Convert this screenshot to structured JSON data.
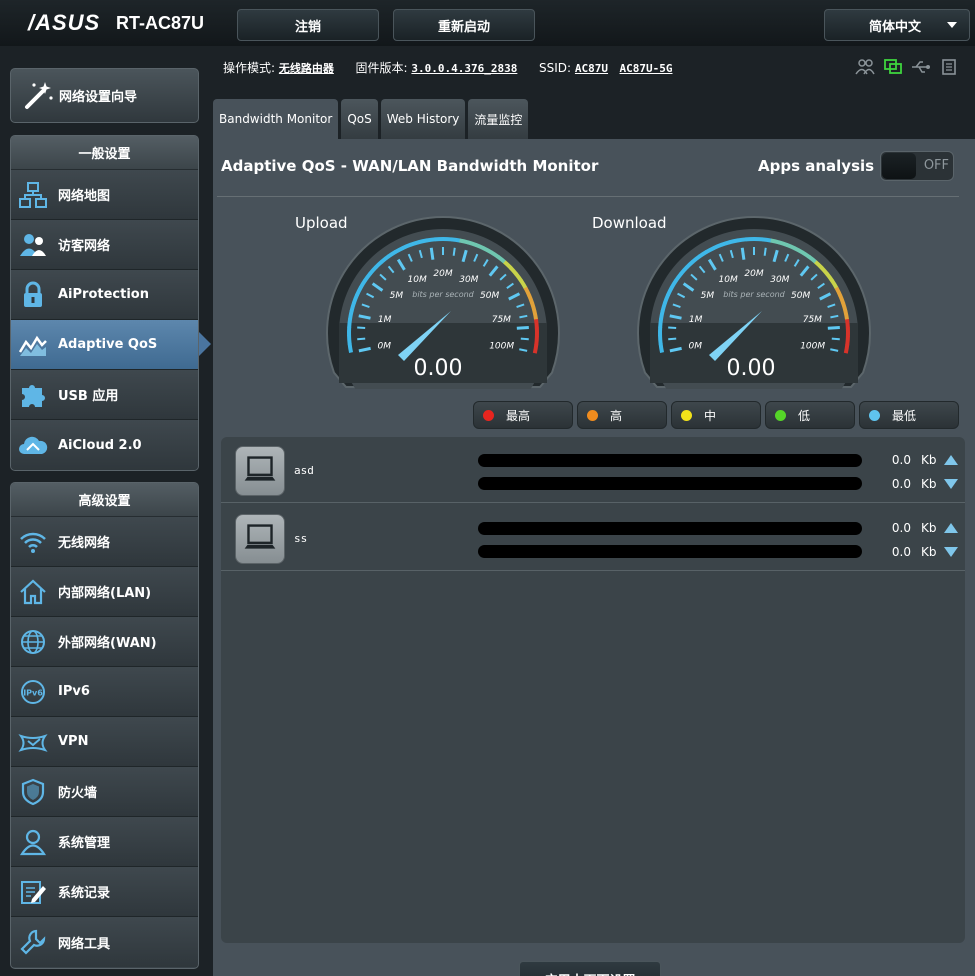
{
  "header": {
    "logo": "/ASUS",
    "model": "RT-AC87U",
    "logout_label": "注销",
    "reboot_label": "重新启动",
    "language": "简体中文"
  },
  "sidebar": {
    "wizard_label": "网络设置向导",
    "general_title": "一般设置",
    "general_items": [
      {
        "label": "网络地图",
        "icon": "network-map-icon"
      },
      {
        "label": "访客网络",
        "icon": "guest-network-icon"
      },
      {
        "label": "AiProtection",
        "icon": "lock-icon"
      },
      {
        "label": "Adaptive QoS",
        "icon": "qos-chart-icon"
      },
      {
        "label": "USB 应用",
        "icon": "puzzle-icon"
      },
      {
        "label": "AiCloud 2.0",
        "icon": "cloud-icon"
      }
    ],
    "advanced_title": "高级设置",
    "advanced_items": [
      {
        "label": "无线网络",
        "icon": "wifi-icon"
      },
      {
        "label": "内部网络(LAN)",
        "icon": "home-icon"
      },
      {
        "label": "外部网络(WAN)",
        "icon": "globe-icon"
      },
      {
        "label": "IPv6",
        "icon": "ipv6-icon"
      },
      {
        "label": "VPN",
        "icon": "vpn-icon"
      },
      {
        "label": "防火墙",
        "icon": "shield-icon"
      },
      {
        "label": "系统管理",
        "icon": "user-icon"
      },
      {
        "label": "系统记录",
        "icon": "log-icon"
      },
      {
        "label": "网络工具",
        "icon": "wrench-icon"
      }
    ]
  },
  "infobar": {
    "mode_label": "操作模式:",
    "mode_value": "无线路由器",
    "firmware_label": "固件版本:",
    "firmware_value": "3.0.0.4.376_2838",
    "ssid_label": "SSID:",
    "ssid_1": "AC87U",
    "ssid_2": "AC87U-5G"
  },
  "tabs": [
    {
      "label": "Bandwidth Monitor"
    },
    {
      "label": "QoS"
    },
    {
      "label": "Web History"
    },
    {
      "label": "流量监控"
    }
  ],
  "panel": {
    "title": "Adaptive QoS - WAN/LAN Bandwidth Monitor",
    "apps_label": "Apps analysis",
    "apps_toggle": "OFF"
  },
  "gauges": {
    "scale_labels": [
      "0M",
      "1M",
      "5M",
      "10M",
      "20M",
      "30M",
      "50M",
      "75M",
      "100M"
    ],
    "unit_text": "bits per second",
    "upload": {
      "label": "Upload",
      "value": "0.00"
    },
    "download": {
      "label": "Download",
      "value": "0.00"
    }
  },
  "legend": [
    {
      "label": "最高",
      "color": "#e8251f"
    },
    {
      "label": "高",
      "color": "#f08c1e"
    },
    {
      "label": "中",
      "color": "#f2e21a"
    },
    {
      "label": "低",
      "color": "#55d428"
    },
    {
      "label": "最低",
      "color": "#5fc4ee"
    }
  ],
  "devices": [
    {
      "name": "asd",
      "up": "0.0",
      "down": "0.0",
      "unit": "Kb"
    },
    {
      "name": "ss",
      "up": "0.0",
      "down": "0.0",
      "unit": "Kb"
    }
  ],
  "apply_label": "应用本页面设置"
}
